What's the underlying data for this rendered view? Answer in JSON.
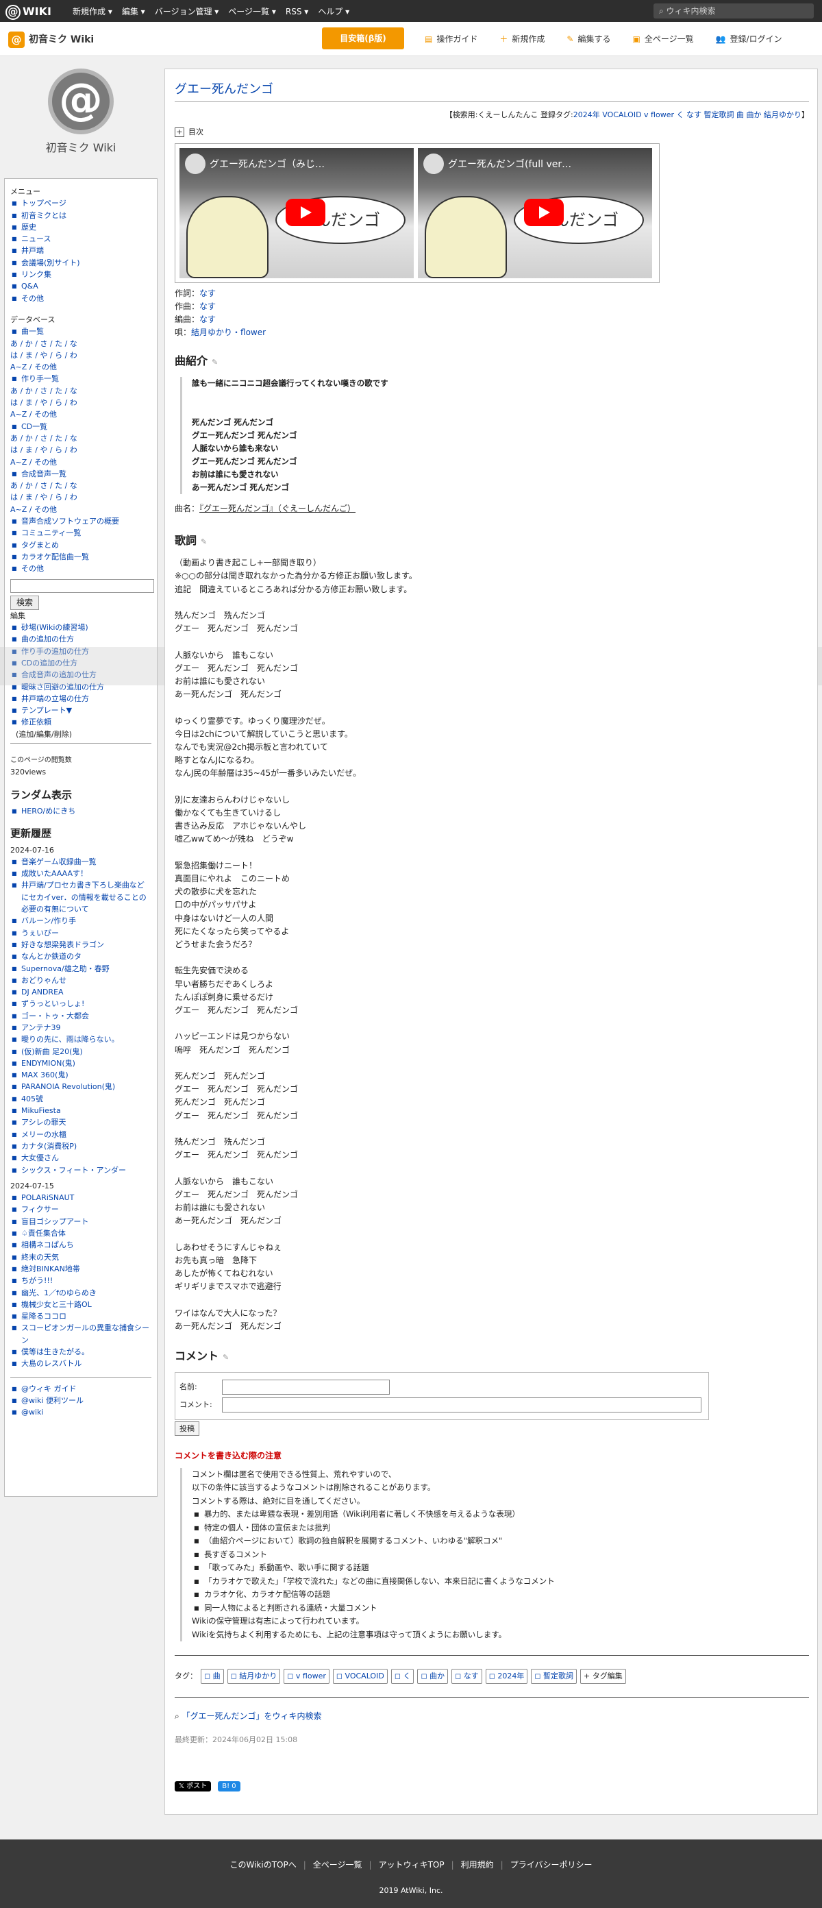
{
  "topbar": {
    "logo": "WIKI",
    "menus": [
      "新規作成 ▾",
      "編集 ▾",
      "バージョン管理 ▾",
      "ページ一覧 ▾",
      "RSS ▾",
      "ヘルプ ▾"
    ],
    "search_placeholder": "ウィキ内検索"
  },
  "sitebar": {
    "name": "初音ミク Wiki",
    "priority": "目安箱(β版)",
    "tools": [
      "操作ガイド",
      "新規作成",
      "編集する",
      "全ページ一覧",
      "登録/ログイン"
    ]
  },
  "side": {
    "logo_text": "@",
    "logo_name": "初音ミク Wiki",
    "menu_title": "メニュー",
    "menu": [
      "トップページ",
      "初音ミクとは",
      "歴史",
      "ニュース",
      "井戸端",
      "会議場(別サイト)",
      "リンク集",
      "Q&A",
      "その他"
    ],
    "db_title": "データベース",
    "db": [
      {
        "label": "曲一覧",
        "rows": [
          "あ / か / さ / た / な",
          "は / ま / や / ら / わ",
          "A~Z / その他"
        ]
      },
      {
        "label": "作り手一覧",
        "rows": [
          "あ / か / さ / た / な",
          "は / ま / や / ら / わ",
          "A~Z / その他"
        ]
      },
      {
        "label": "CD一覧",
        "rows": [
          "あ / か / さ / た / な",
          "は / ま / や / ら / わ",
          "A~Z / その他"
        ]
      },
      {
        "label": "合成音声一覧",
        "rows": [
          "あ / か / さ / た / な",
          "は / ま / や / ら / わ",
          "A~Z / その他"
        ]
      }
    ],
    "more": [
      "音声合成ソフトウェアの概要",
      "コミュニティ一覧",
      "タグまとめ",
      "カラオケ配信曲一覧",
      "その他"
    ],
    "search_btn": "検索",
    "edit_title": "編集",
    "edit": [
      "砂場(Wikiの練習場)",
      "曲の追加の仕方",
      "作り手の追加の仕方",
      "CDの追加の仕方",
      "合成音声の追加の仕方",
      "曖昧さ回避の追加の仕方",
      "井戸端の立場の仕方",
      "テンプレート▼",
      "修正依頼"
    ],
    "edit_note": "(追加/編集/削除)",
    "views_label": "このページの閲覧数",
    "views": "320views",
    "random_title": "ランダム表示",
    "random": [
      "HERO/めにきち"
    ],
    "recent_title": "更新履歴",
    "date1": "2024-07-16",
    "recent1": [
      "音楽ゲーム収録曲一覧",
      "成敗いたAAAAす！",
      "井戸端/プロセカ書き下ろし楽曲などにセカイver．の情報を載せることの必要の有無について",
      "バルーン/作り手",
      "うぇいびー",
      "好きな想梁発表ドラゴン",
      "なんとか鉄道のタ",
      "Supernova/雄之助・春野",
      "おどりゃんせ",
      "DJ ANDREA",
      "ずうっといっしょ!",
      "ゴー・トゥ・大都会",
      "アンテナ39",
      "曖りの先に、雨は降らない。",
      "(仮)新曲 足20(鬼)",
      "ENDYMION(鬼)",
      "MAX 360(鬼)",
      "PARANOIA Revolution(鬼)",
      "405號",
      "MikuFiesta",
      "アシレの罪天",
      "メリーの水櫃",
      "カナタ(消費税P)",
      "大女優さん",
      "シックス・フィート・アンダー"
    ],
    "date2": "2024-07-15",
    "recent2": [
      "POLARiSNAUT",
      "フィクサー",
      "盲目ゴシップアート",
      "♤責任集合体",
      "相構ネコぱんち",
      "終末の天気",
      "絶対BINKAN地帯",
      "ちがう!!!",
      "幽光、1／fのゆらめき",
      "機械少女と三十路OL",
      "星降るココロ",
      "スコーピオンガールの異重な捕食シーン",
      "僕等は生きたがる。",
      "大島のレスバトル"
    ],
    "footer_links": [
      "@ウィキ ガイド",
      "@wiki 便利ツール",
      "@wiki"
    ]
  },
  "main": {
    "title": "グエー死んだンゴ",
    "tagline_prefix": "【検索用:くえーしんたんこ 登録タグ:",
    "tag_links": [
      "2024年",
      "VOCALOID",
      "v flower",
      "く",
      "なす",
      "暫定歌詞",
      "曲",
      "曲か",
      "結月ゆかり"
    ],
    "tagline_suffix": "】",
    "toc": "目次",
    "video1_title": "グエー死んだンゴ（みじ…",
    "video2_title": "グエー死んだンゴ(full ver…",
    "video_overlay": "んだンゴ",
    "credits": [
      {
        "label": "作詞：",
        "value": "なす"
      },
      {
        "label": "作曲：",
        "value": "なす"
      },
      {
        "label": "編曲：",
        "value": "なす"
      },
      {
        "label": "唄：",
        "value": "結月ゆかり・flower"
      }
    ],
    "intro_title": "曲紹介",
    "edit_mark": "✎",
    "intro_lead": "誰も一緒にニコニコ超会議行ってくれない嘆きの歌です",
    "intro_lines": [
      "死んだンゴ 死んだンゴ",
      "グエー死んだンゴ 死んだンゴ",
      "人脈ないから誰も来ない",
      "グエー死んだンゴ 死んだンゴ",
      "お前は誰にも愛されない",
      "あー死んだンゴ 死んだンゴ"
    ],
    "song_name_label": "曲名：",
    "song_name": "『グエー死んだンゴ』（ぐえーしんだんご）",
    "lyrics_title": "歌詞",
    "lyrics_note": "（動画より書き起こし+一部聞き取り）\n※○○の部分は聞き取れなかった為分かる方修正お願い致します。\n追記　間違えているところあれば分かる方修正お願い致します。",
    "lyrics": "㱡んだンゴ　㱡んだンゴ\nグエー　死んだンゴ　死んだンゴ\n\n人脈ないから　誰もこない\nグエー　死んだンゴ　死んだンゴ\nお前は誰にも愛されない\nあー死んだンゴ　死んだンゴ\n\nゆっくり霊夢です。ゆっくり魔理沙だぜ。\n今日は2chについて解説していこうと思います。\nなんでも実況@2ch掲示板と言われていて\n略すとなんJになるわ。\nなんJ民の年齢層は35~45が一番多いみたいだぜ。\n\n別に友達おらんわけじゃないし\n働かなくても生きていけるし\n書き込み反応　アホじゃないんやし\n嘘乙wwてめ～が㱡ね　どうぞw\n\n緊急招集働けニート！\n真面目にやれよ　このニートめ\n犬の散歩に犬を忘れた\n口の中がパッサパサよ\n中身はないけど一人の人間\n死にたくなったら笑ってやるよ\nどうせまた会うだろ？\n\n転生先安価で決める\n早い者勝ちだぞあくしろよ\nたんぽぽ刺身に乗せるだけ\nグエー　死んだンゴ　死んだンゴ\n\nハッピーエンドは見つからない\n嗚呼　死んだンゴ　死んだンゴ\n\n死んだンゴ　死んだンゴ\nグエー　死んだンゴ　死んだンゴ\n死んだンゴ　死んだンゴ\nグエー　死んだンゴ　死んだンゴ\n\n㱡んだンゴ　㱡んだンゴ\nグエー　死んだンゴ　死んだンゴ\n\n人脈ないから　誰もこない\nグエー　死んだンゴ　死んだンゴ\nお前は誰にも愛されない\nあー死んだンゴ　死んだンゴ\n\nしあわせそうにすんじゃねぇ\nお先も真っ暗　急降下\nあしたが怖くてねむれない\nギリギリまでスマホで逃避行\n\nワイはなんで大人になった？\nあー死んだンゴ　死んだンゴ",
    "comment_title": "コメント",
    "name_label": "名前:",
    "comment_label": "コメント:",
    "post_btn": "投稿",
    "notice_title": "コメントを書き込む際の注意",
    "notice_lead": [
      "コメント欄は匿名で使用できる性質上、荒れやすいので、",
      "以下の条件に該当するようなコメントは削除されることがあります。",
      "コメントする際は、絶対に目を通してください。"
    ],
    "notice_items": [
      "暴力的、または卑猥な表現・差別用語（Wiki利用者に著しく不快感を与えるような表現）",
      "特定の個人・団体の宣伝または批判",
      "（曲紹介ページにおいて）歌詞の独自解釈を展開するコメント、いわゆる\"解釈コメ\"",
      "長すぎるコメント",
      "「歌ってみた」系動画や、歌い手に関する話題",
      "「カラオケで歌えた」「学校で流れた」などの曲に直接関係しない、本来日記に書くようなコメント",
      "カラオケ化、カラオケ配信等の話題",
      "同一人物によると判断される連続・大量コメント"
    ],
    "notice_tail": [
      "Wikiの保守管理は有志によって行われています。",
      "Wikiを気持ちよく利用するためにも、上記の注意事項は守って頂くようにお願いします。"
    ],
    "tags_label": "タグ：",
    "tags": [
      "曲",
      "結月ゆかり",
      "v flower",
      "VOCALOID",
      "く",
      "曲か",
      "なす",
      "2024年",
      "暫定歌詞"
    ],
    "tag_add": "+ タグ編集",
    "search_link": "「グエー死んだンゴ」をウィキ内検索",
    "updated": "最終更新：2024年06月02日 15:08",
    "share_x": "𝕏 ポスト",
    "share_b": "B! 0"
  },
  "footer": {
    "links": [
      "このWikiのTOPへ",
      "全ページ一覧",
      "アットウィキTOP",
      "利用規約",
      "プライバシーポリシー"
    ],
    "copy": "2019 AtWiki, Inc."
  }
}
